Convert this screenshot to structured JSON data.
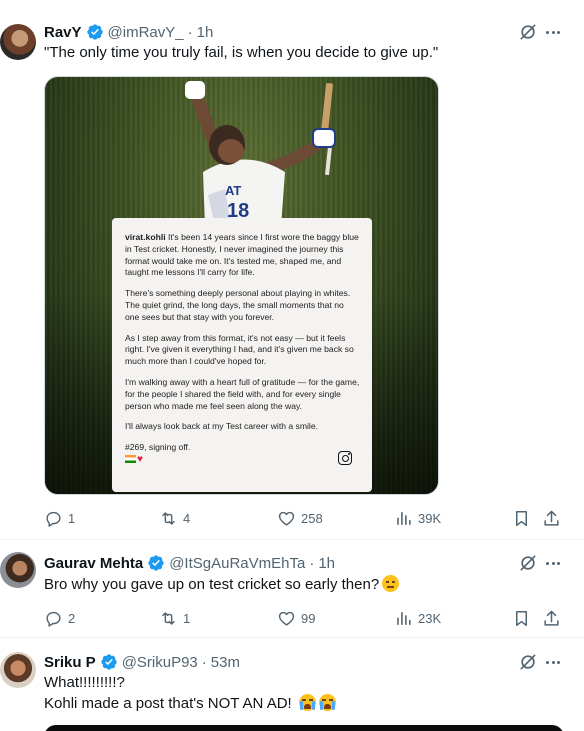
{
  "colors": {
    "accent": "#1d9bf0",
    "muted": "#536471",
    "text": "#0f1419"
  },
  "tweets": [
    {
      "name": "RavY",
      "handle": "@imRavY_",
      "time": "1h",
      "text": "\"The only time you truly fail, is when you decide to give up.\"",
      "replies": "1",
      "reposts": "4",
      "likes": "258",
      "views": "39K",
      "media": {
        "username": "virat.kohli",
        "paragraphs": [
          "It's been 14 years since I first wore the baggy blue in Test cricket. Honestly, I never imagined the journey this format would take me on. It's tested me, shaped me, and taught me lessons I'll carry for life.",
          "There's something deeply personal about playing in whites. The quiet grind, the long days, the small moments that no one sees but that stay with you forever.",
          "As I step away from this format, it's not easy — but it feels right. I've given it everything I had, and it's given me back so much more than I could've hoped for.",
          "I'm walking away with a heart full of gratitude — for the game, for the people I shared the field with, and for every single person who made me feel seen along the way.",
          "I'll always look back at my Test career with a smile."
        ],
        "signoff": "#269, signing off.",
        "jersey_text": "AT"
      }
    },
    {
      "name": "Gaurav Mehta",
      "handle": "@ItSgAuRaVmEhTa",
      "time": "1h",
      "text": "Bro why you gave up on test cricket so early then?",
      "replies": "2",
      "reposts": "1",
      "likes": "99",
      "views": "23K"
    },
    {
      "name": "Sriku P",
      "handle": "@SrikuP93",
      "time": "53m",
      "text_line1": "What!!!!!!!!!?",
      "text_line2": "Kohli made a post that's NOT AN AD!"
    }
  ],
  "icons": [
    "verified-icon",
    "grok-icon",
    "more-icon",
    "reply-icon",
    "repost-icon",
    "like-icon",
    "views-icon",
    "bookmark-icon",
    "share-icon",
    "instagram-icon"
  ]
}
